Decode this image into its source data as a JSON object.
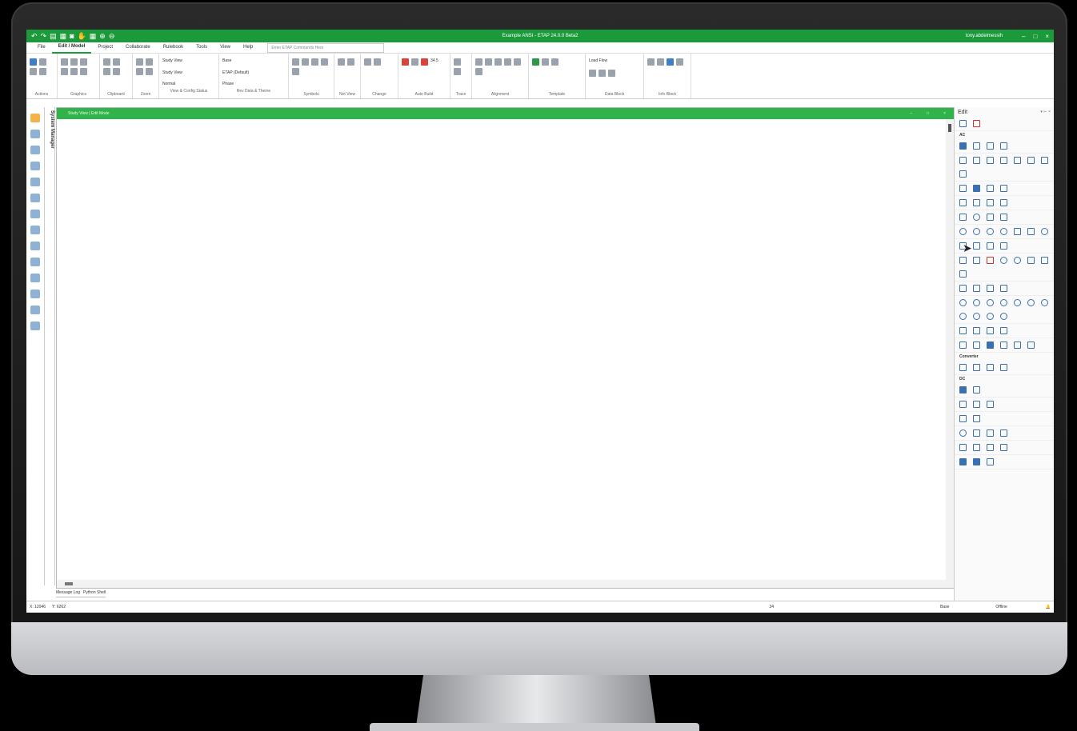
{
  "app": {
    "title": "Example ANSI - ETAP 24.0.0 Beta2",
    "user": "tony.abdelmessih"
  },
  "menu": {
    "tabs": [
      "File",
      "Edit / Model",
      "Project",
      "Collaborate",
      "Rulebook",
      "Tools",
      "View",
      "Help"
    ],
    "active": "Edit / Model",
    "search_placeholder": "Enter ETAP Commands Here"
  },
  "ribbon": {
    "groups": [
      "Actions",
      "Graphics",
      "Clipboard",
      "Zoom",
      "View & Config Status",
      "Rev Data & Theme",
      "Symbols",
      "Net View",
      "Change",
      "Auto Build",
      "Trace",
      "Alignment",
      "Template",
      "Data Block",
      "Info Block"
    ],
    "view_select": "Study View",
    "theme_select": "ETAP (Default)",
    "config_select": "Normal",
    "phase_select": "Phase",
    "base_select": "Base",
    "load_filter": "Load Flow",
    "font_size": "34.5"
  },
  "system_manager": {
    "label": "System Manager"
  },
  "document": {
    "title": "Study View | Edit Mode"
  },
  "bottom_tabs": {
    "message_log": "Message Log",
    "python_shell": "Python Shell"
  },
  "edit_panel": {
    "title": "Edit",
    "sections": {
      "ac": "AC",
      "converter": "Converter",
      "dc": "DC"
    }
  },
  "status": {
    "x": "X: 12046",
    "y": "Y: 6262",
    "zoom": "34",
    "snap": "Base",
    "connection": "Offline"
  },
  "colors": {
    "brand_green": "#1a9a3a",
    "doc_green": "#2fb34a"
  }
}
